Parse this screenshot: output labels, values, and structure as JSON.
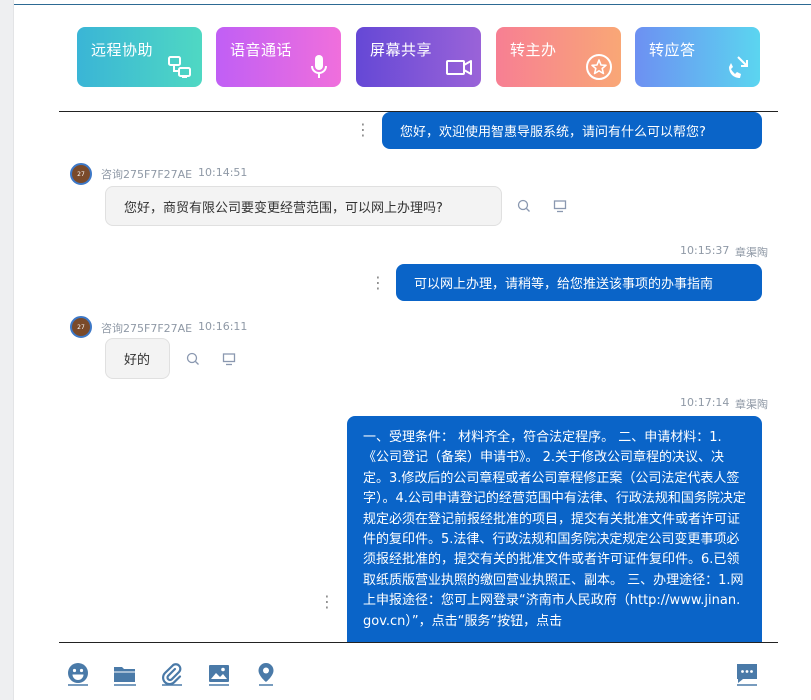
{
  "actions": [
    {
      "label": "远程协助",
      "icon": "remote-desktop-icon"
    },
    {
      "label": "语音通话",
      "icon": "microphone-icon"
    },
    {
      "label": "屏幕共享",
      "icon": "video-camera-icon"
    },
    {
      "label": "转主办",
      "icon": "star-circle-icon"
    },
    {
      "label": "转应答",
      "icon": "phone-transfer-icon"
    }
  ],
  "messages": {
    "m1": {
      "text": "您好，欢迎使用智惠导服系统，请问有什么可以帮您?"
    },
    "m2": {
      "sender": "咨询275F7F27AE",
      "time": "10:14:51",
      "avatar": "27",
      "text": "您好，商贸有限公司要变更经营范围，可以网上办理吗?"
    },
    "m3": {
      "sender": "章渠陶",
      "time": "10:15:37",
      "text": "可以网上办理，请稍等，给您推送该事项的办事指南"
    },
    "m4": {
      "sender": "咨询275F7F27AE",
      "time": "10:16:11",
      "avatar": "27",
      "text": "好的"
    },
    "m5": {
      "sender": "章渠陶",
      "time": "10:17:14",
      "text": "一、受理条件： 材料齐全，符合法定程序。 二、申请材料：1.《公司登记（备案）申请书》。 2.关于修改公司章程的决议、决定。3.修改后的公司章程或者公司章程修正案（公司法定代表人签字）。4.公司申请登记的经营范围中有法律、行政法规和国务院决定规定必须在登记前报经批准的项目，提交有关批准文件或者许可证件的复印件。5.法律、行政法规和国务院决定规定公司变更事项必须报经批准的，提交有关的批准文件或者许可证件复印件。6.已领取纸质版营业执照的缴回营业执照正、副本。 三、办理途径：1.网上申报途径：您可上网登录“济南市人民政府（http://www.jinan.gov.cn）”，点击“服务”按钮，点击"
    }
  },
  "colors": {
    "outgoing": "#0a64c8",
    "incoming": "#f3f3f3",
    "icon": "#4a7aa8"
  },
  "toolbar": [
    {
      "icon": "emoji-icon"
    },
    {
      "icon": "folder-icon"
    },
    {
      "icon": "attachment-icon"
    },
    {
      "icon": "image-icon"
    },
    {
      "icon": "location-icon"
    },
    {
      "icon": "chat-message-icon"
    }
  ]
}
